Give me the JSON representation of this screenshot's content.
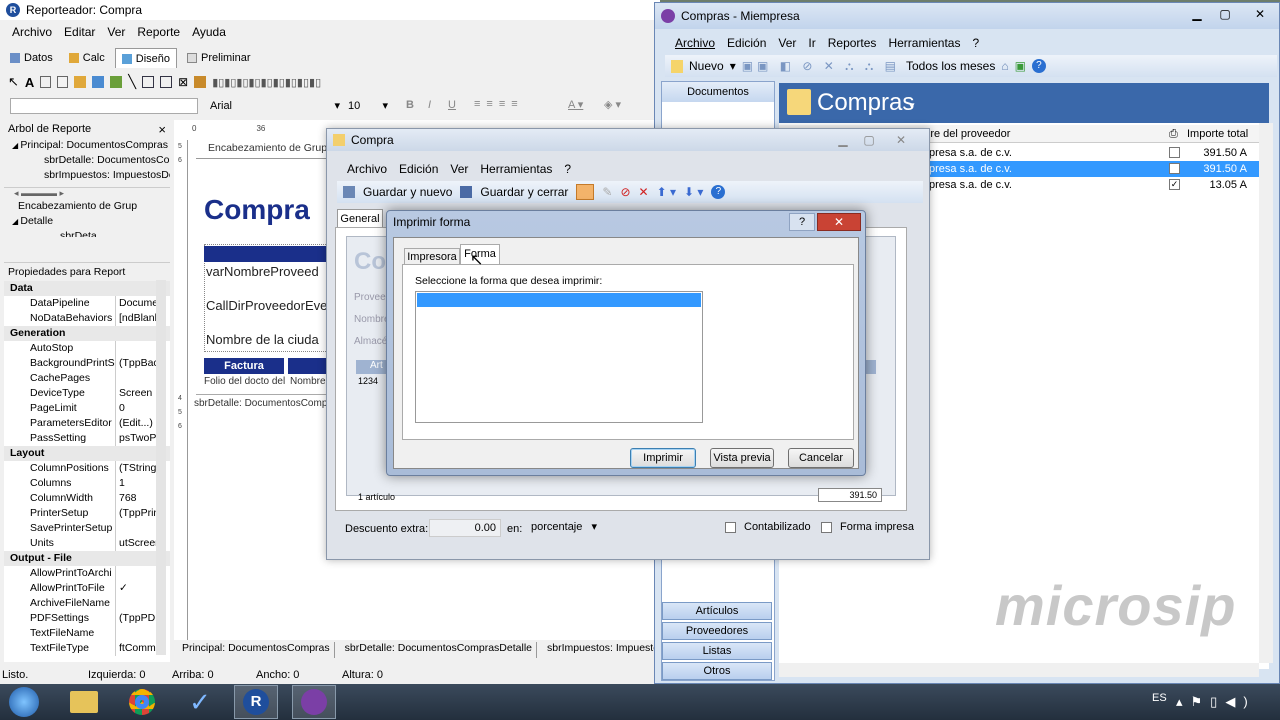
{
  "reporteador": {
    "title": "Reporteador: Compra",
    "menu": [
      "Archivo",
      "Editar",
      "Ver",
      "Reporte",
      "Ayuda"
    ],
    "tabs": [
      "Datos",
      "Calc",
      "Diseño",
      "Preliminar"
    ],
    "font_name": "Arial",
    "font_size": "10",
    "tree_title": "Arbol de Reporte",
    "tree_items": [
      "Principal: DocumentosCompras",
      "sbrDetalle: DocumentosCom",
      "sbrImpuestos: ImpuestosDc"
    ],
    "tree2_items": [
      "Encabezamiento de Grup",
      "Detalle",
      "sbrDeta"
    ],
    "props_title": "Propiedades para Report",
    "prop_groups": [
      {
        "name": "Data",
        "rows": [
          [
            "DataPipeline",
            "Docume"
          ],
          [
            "NoDataBehaviors",
            "[ndBlank"
          ]
        ]
      },
      {
        "name": "Generation",
        "rows": [
          [
            "AutoStop",
            ""
          ],
          [
            "BackgroundPrintSe",
            "(TppBac"
          ],
          [
            "CachePages",
            ""
          ],
          [
            "DeviceType",
            "Screen"
          ],
          [
            "PageLimit",
            "0"
          ],
          [
            "ParametersEditor",
            "(Edit...)"
          ],
          [
            "PassSetting",
            "psTwoP"
          ]
        ]
      },
      {
        "name": "Layout",
        "rows": [
          [
            "ColumnPositions",
            "(TString"
          ],
          [
            "Columns",
            "1"
          ],
          [
            "ColumnWidth",
            "768"
          ],
          [
            "PrinterSetup",
            "(TppPrin"
          ],
          [
            "SavePrinterSetup",
            ""
          ],
          [
            "Units",
            "utScreen"
          ]
        ]
      },
      {
        "name": "Output - File",
        "rows": [
          [
            "AllowPrintToArchi",
            ""
          ],
          [
            "AllowPrintToFile",
            "✓"
          ],
          [
            "ArchiveFileName",
            ""
          ],
          [
            "PDFSettings",
            "(TppPDF"
          ],
          [
            "TextFileName",
            ""
          ],
          [
            "TextFileType",
            "ftComm"
          ]
        ]
      }
    ],
    "design": {
      "band_header": "Encabezamiento de Grup",
      "title_text": "Compra",
      "field1": "varNombreProveed",
      "field2": "CallDirProveedorEve",
      "field3": "Nombre de la ciuda",
      "factura": "Factura",
      "folio": "Folio del docto del",
      "nombre": "Nombre",
      "sbr": "sbrDetalle: DocumentosComp"
    },
    "bottom_tabs": [
      "Principal: DocumentosCompras",
      "sbrDetalle: DocumentosComprasDetalle",
      "sbrImpuestos: ImpuestosDoct"
    ],
    "status": {
      "left": "Listo.",
      "izquierda": "Izquierda: 0",
      "arriba": "Arriba: 0",
      "ancho": "Ancho: 0",
      "altura": "Altura: 0"
    }
  },
  "microsip": {
    "title": "Compras - Miempresa",
    "menu": [
      "Archivo",
      "Edición",
      "Ver",
      "Ir",
      "Reportes",
      "Herramientas",
      "?"
    ],
    "nuevo": "Nuevo",
    "filter": "Todos los meses",
    "nav_header": "Documentos",
    "heading": "Compras",
    "col_proveedor": "Nombre del proveedor",
    "col_importe": "Importe total",
    "rows": [
      {
        "proveedor": "presa s.a. de c.v.",
        "importe": "391.50",
        "flag": "A",
        "checked": false
      },
      {
        "proveedor": "presa s.a. de c.v.",
        "importe": "391.50",
        "flag": "A",
        "checked": false
      },
      {
        "proveedor": "presa s.a. de c.v.",
        "importe": "13.05",
        "flag": "A",
        "checked": true
      }
    ],
    "nav_buttons": [
      "Artículos",
      "Proveedores",
      "Listas",
      "Otros"
    ],
    "watermark": "microsip"
  },
  "compra": {
    "title": "Compra",
    "menu": [
      "Archivo",
      "Edición",
      "Ver",
      "Herramientas",
      "?"
    ],
    "guardar_nuevo": "Guardar y nuevo",
    "guardar_cerrar": "Guardar y cerrar",
    "tab_general": "General",
    "labels": [
      "Proveedo",
      "Nombre",
      "Almacén"
    ],
    "grid_header": "Art",
    "grid_value": "1234",
    "articulos": "1 artículo",
    "total": "391.50",
    "descuento_label": "Descuento extra:",
    "descuento_value": "0.00",
    "en_label": "en:",
    "en_value": "porcentaje",
    "contabilizado": "Contabilizado",
    "forma_impresa": "Forma impresa"
  },
  "dialog": {
    "title": "Imprimir forma",
    "tab_impresora": "Impresora",
    "tab_forma": "Forma",
    "prompt": "Seleccione la forma que desea imprimir:",
    "btn_imprimir": "Imprimir",
    "btn_vista": "Vista previa",
    "btn_cancelar": "Cancelar"
  },
  "taskbar": {
    "lang": "ES"
  }
}
